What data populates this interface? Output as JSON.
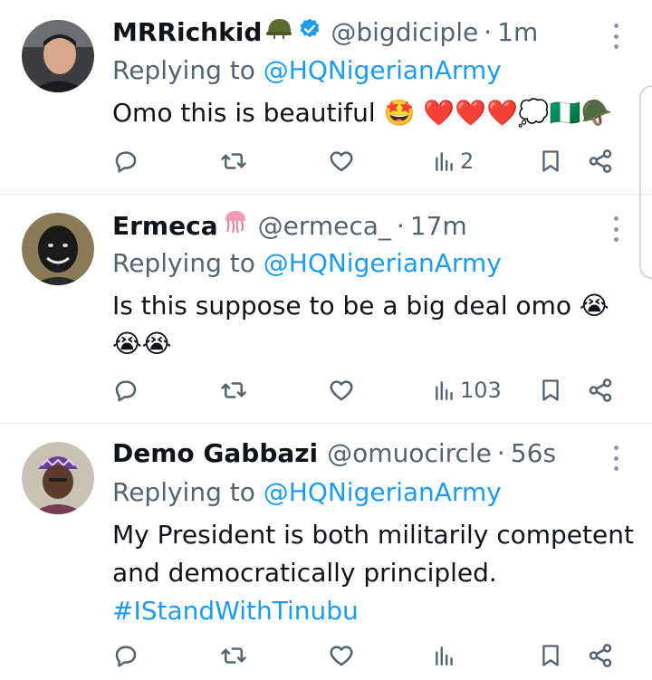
{
  "tweets": [
    {
      "name": "MRRichkid",
      "handle": "@bigdiciple",
      "time": "1m",
      "verified": true,
      "replying_prefix": "Replying to",
      "replying_to": "@HQNigerianArmy",
      "text": "Omo this is beautiful 🤩 ❤️❤️❤️💭🇳🇬🪖",
      "views": "2"
    },
    {
      "name": "Ermeca",
      "handle": "@ermeca_",
      "time": "17m",
      "replying_prefix": "Replying to",
      "replying_to": "@HQNigerianArmy",
      "text_line1": "Is this suppose to be a big deal omo 😭",
      "text_line2": "😭😭",
      "views": "103"
    },
    {
      "name": "Demo Gabbazi",
      "handle": "@omuocircle",
      "time": "56s",
      "replying_prefix": "Replying to",
      "replying_to": "@HQNigerianArmy",
      "text_line1": "My President is both militarily competent",
      "text_line2": "and democratically principled.",
      "hashtag": "#IStandWithTinubu",
      "views": ""
    }
  ],
  "colors": {
    "accent": "#1d9bf0",
    "secondary_text": "#536471",
    "divider": "#e6ecf0"
  }
}
